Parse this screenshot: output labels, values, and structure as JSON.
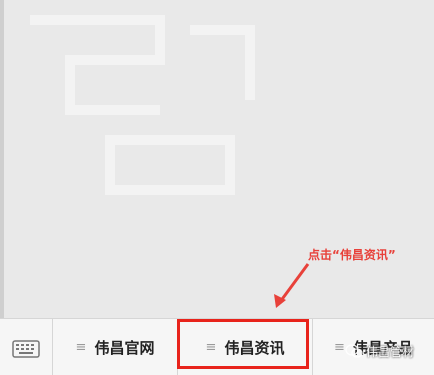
{
  "annotation": {
    "text": "点击“伟昌资讯”",
    "color": "#e8413a"
  },
  "menu": {
    "keyboard_icon": "keyboard-icon",
    "items": [
      {
        "label": "伟昌官网",
        "icon": "menu-lines-icon"
      },
      {
        "label": "伟昌资讯",
        "icon": "menu-lines-icon"
      },
      {
        "label": "伟昌产品",
        "icon": "menu-lines-icon"
      }
    ],
    "menu_icon_glyph": "≡"
  },
  "highlight": {
    "color": "#e8231b",
    "target_index": 1
  },
  "watermark": {
    "text": "伟昌管材",
    "icon": "wechat-icon"
  }
}
